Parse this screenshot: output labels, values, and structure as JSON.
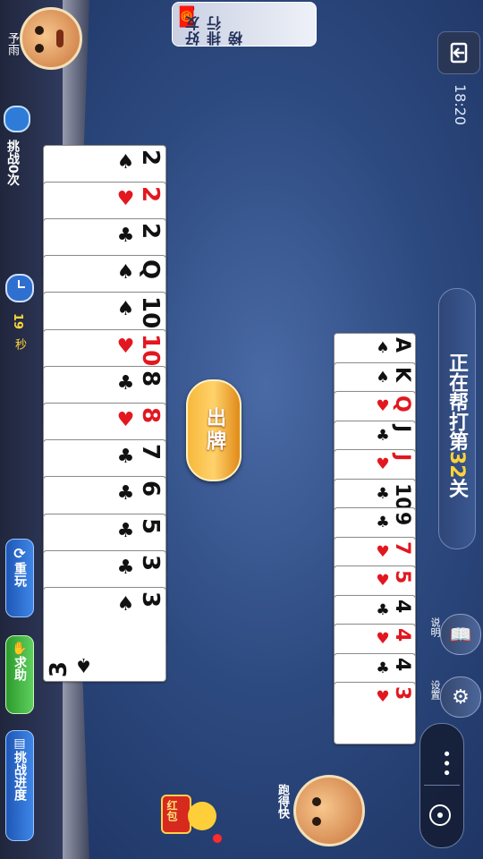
{
  "status_bar": {
    "time": "18:20"
  },
  "top": {
    "leaderboard_button": "好友排行榜",
    "player_name": "予雨"
  },
  "left_panel": {
    "challenge_count": "挑战0次",
    "timer_value": "19",
    "timer_unit": "秒",
    "replay_button": "重玩",
    "help_button": "求助",
    "progress_button": "挑战进度"
  },
  "level": {
    "prefix": "正在帮打第",
    "number": "32",
    "suffix": "关"
  },
  "right_menu": {
    "rules_label": "说明",
    "settings_label": "设置"
  },
  "opponent": {
    "name": "跑得快"
  },
  "red_packet_label": "红包",
  "play_button": "出牌",
  "player_hand": [
    {
      "rank": "3",
      "suit": "♠",
      "color": "black"
    },
    {
      "rank": "3",
      "suit": "♣",
      "color": "black"
    },
    {
      "rank": "5",
      "suit": "♣",
      "color": "black"
    },
    {
      "rank": "6",
      "suit": "♣",
      "color": "black"
    },
    {
      "rank": "7",
      "suit": "♣",
      "color": "black"
    },
    {
      "rank": "8",
      "suit": "♥",
      "color": "red"
    },
    {
      "rank": "8",
      "suit": "♣",
      "color": "black"
    },
    {
      "rank": "10",
      "suit": "♥",
      "color": "red"
    },
    {
      "rank": "10",
      "suit": "♠",
      "color": "black"
    },
    {
      "rank": "Q",
      "suit": "♠",
      "color": "black"
    },
    {
      "rank": "2",
      "suit": "♣",
      "color": "black"
    },
    {
      "rank": "2",
      "suit": "♥",
      "color": "red"
    },
    {
      "rank": "2",
      "suit": "♠",
      "color": "black"
    }
  ],
  "opponent_cards": [
    {
      "rank": "3",
      "suit": "♥",
      "color": "red"
    },
    {
      "rank": "4",
      "suit": "♣",
      "color": "black"
    },
    {
      "rank": "4",
      "suit": "♥",
      "color": "red"
    },
    {
      "rank": "4",
      "suit": "♣",
      "color": "black"
    },
    {
      "rank": "5",
      "suit": "♥",
      "color": "red"
    },
    {
      "rank": "7",
      "suit": "♥",
      "color": "red"
    },
    {
      "rank": "9",
      "suit": "♣",
      "color": "black"
    },
    {
      "rank": "10",
      "suit": "♣",
      "color": "black"
    },
    {
      "rank": "J",
      "suit": "♥",
      "color": "red"
    },
    {
      "rank": "J",
      "suit": "♣",
      "color": "black"
    },
    {
      "rank": "Q",
      "suit": "♥",
      "color": "red"
    },
    {
      "rank": "K",
      "suit": "♠",
      "color": "black"
    },
    {
      "rank": "A",
      "suit": "♠",
      "color": "black"
    }
  ]
}
